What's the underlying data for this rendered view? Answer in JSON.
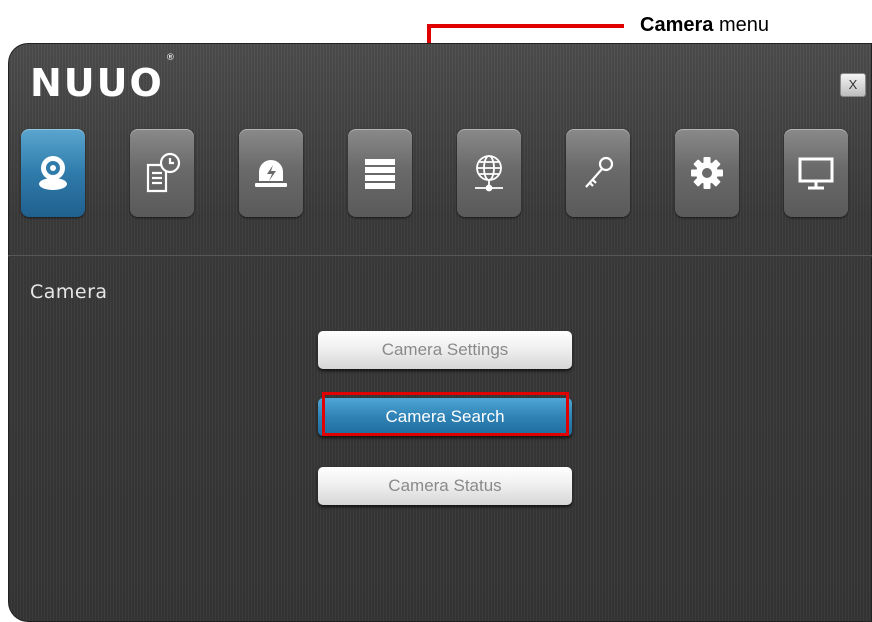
{
  "callout": {
    "bold_text": "Camera",
    "rest_text": " menu",
    "color": "#e00000"
  },
  "window": {
    "logo": "NUUO",
    "logo_mark": "®",
    "close_label": "X"
  },
  "toolbar": {
    "items": [
      {
        "name": "camera",
        "icon": "webcam-icon",
        "active": true
      },
      {
        "name": "schedule",
        "icon": "schedule-icon",
        "active": false
      },
      {
        "name": "event",
        "icon": "alarm-icon",
        "active": false
      },
      {
        "name": "storage",
        "icon": "storage-icon",
        "active": false
      },
      {
        "name": "network",
        "icon": "globe-network-icon",
        "active": false
      },
      {
        "name": "user",
        "icon": "key-icon",
        "active": false
      },
      {
        "name": "system",
        "icon": "gear-icon",
        "active": false
      },
      {
        "name": "display",
        "icon": "monitor-icon",
        "active": false
      }
    ],
    "active_color": "#2f7bab"
  },
  "section": {
    "title": "Camera"
  },
  "menu": {
    "settings_label": "Camera Settings",
    "search_label": "Camera Search",
    "status_label": "Camera Status",
    "selected": "Camera Search"
  }
}
